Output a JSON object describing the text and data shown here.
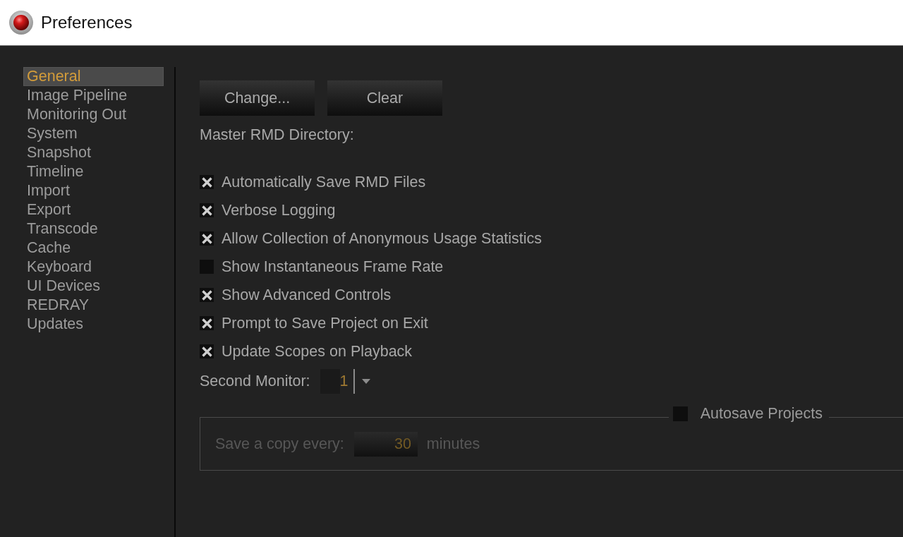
{
  "window": {
    "title": "Preferences"
  },
  "sidebar": {
    "items": [
      {
        "label": "General",
        "selected": true
      },
      {
        "label": "Image Pipeline",
        "selected": false
      },
      {
        "label": "Monitoring Out",
        "selected": false
      },
      {
        "label": "System",
        "selected": false
      },
      {
        "label": "Snapshot",
        "selected": false
      },
      {
        "label": "Timeline",
        "selected": false
      },
      {
        "label": "Import",
        "selected": false
      },
      {
        "label": "Export",
        "selected": false
      },
      {
        "label": "Transcode",
        "selected": false
      },
      {
        "label": "Cache",
        "selected": false
      },
      {
        "label": "Keyboard",
        "selected": false
      },
      {
        "label": "UI Devices",
        "selected": false
      },
      {
        "label": "REDRAY",
        "selected": false
      },
      {
        "label": "Updates",
        "selected": false
      }
    ]
  },
  "directory": {
    "buttons": [
      "Change...",
      "Clear"
    ],
    "label": "Master RMD Directory:"
  },
  "options": [
    {
      "label": "Automatically Save RMD Files",
      "checked": true
    },
    {
      "label": "Verbose Logging",
      "checked": true
    },
    {
      "label": "Allow Collection of Anonymous Usage Statistics",
      "checked": true
    },
    {
      "label": "Show Instantaneous Frame Rate",
      "checked": false
    },
    {
      "label": "Show Advanced Controls",
      "checked": true
    },
    {
      "label": "Prompt to Save Project on Exit",
      "checked": true
    },
    {
      "label": "Update Scopes on Playback",
      "checked": true
    }
  ],
  "second_monitor": {
    "label": "Second Monitor:",
    "value": "1"
  },
  "autosave": {
    "title": "Autosave Projects",
    "checked": false,
    "interval_label": "Save a copy every:",
    "interval_value": "30",
    "unit": "minutes"
  }
}
